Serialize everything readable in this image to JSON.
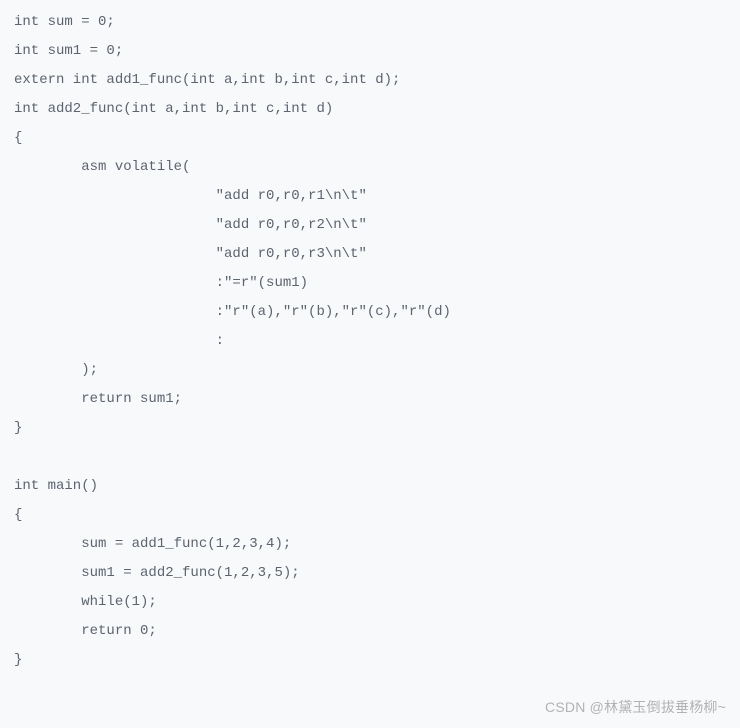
{
  "code": {
    "lines": [
      "int sum = 0;",
      "int sum1 = 0;",
      "extern int add1_func(int a,int b,int c,int d);",
      "int add2_func(int a,int b,int c,int d)",
      "{",
      "        asm volatile(",
      "                        \"add r0,r0,r1\\n\\t\"",
      "                        \"add r0,r0,r2\\n\\t\"",
      "                        \"add r0,r0,r3\\n\\t\"",
      "                        :\"=r\"(sum1)",
      "                        :\"r\"(a),\"r\"(b),\"r\"(c),\"r\"(d)",
      "                        :",
      "        );",
      "        return sum1;",
      "}",
      "",
      "int main()",
      "{",
      "        sum = add1_func(1,2,3,4);",
      "        sum1 = add2_func(1,2,3,5);",
      "        while(1);",
      "        return 0;",
      "}"
    ]
  },
  "watermark": {
    "text": "CSDN @林黛玉倒拔垂杨柳~"
  }
}
